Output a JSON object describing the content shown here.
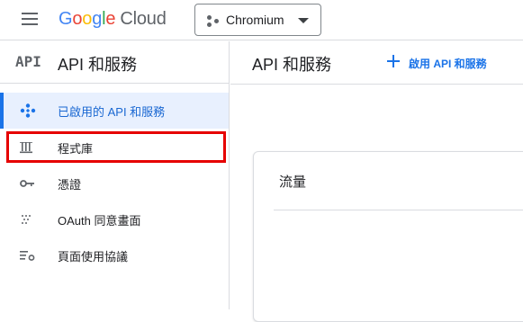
{
  "header": {
    "logo": {
      "google": "Google",
      "cloud": "Cloud"
    },
    "project_picker": {
      "label": "Chromium"
    }
  },
  "sidebar": {
    "title": "API 和服務",
    "logo_text": "API",
    "items": [
      {
        "label": "已啟用的 API 和服務",
        "icon": "api-diamond-icon",
        "active": true
      },
      {
        "label": "程式庫",
        "icon": "library-icon",
        "active": false
      },
      {
        "label": "憑證",
        "icon": "key-icon",
        "active": false
      },
      {
        "label": "OAuth 同意畫面",
        "icon": "oauth-dots-icon",
        "active": false
      },
      {
        "label": "頁面使用協議",
        "icon": "settings-list-icon",
        "active": false
      }
    ]
  },
  "main": {
    "title": "API 和服務",
    "enable_button": "啟用 API 和服務",
    "card": {
      "title": "流量"
    }
  },
  "colors": {
    "accent": "#1a73e8",
    "active_bg": "#e8f0fe",
    "highlight_border": "#e60000"
  }
}
